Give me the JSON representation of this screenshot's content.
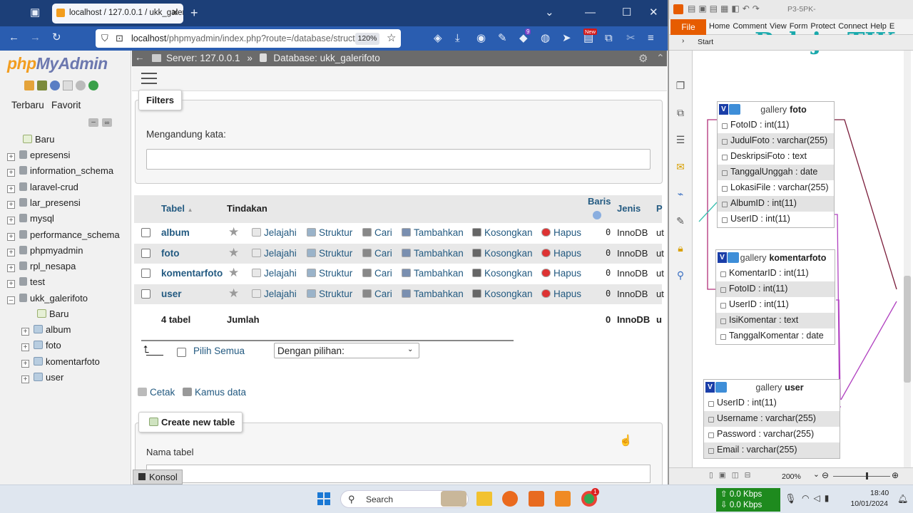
{
  "browser": {
    "tab_title": "localhost / 127.0.0.1 / ukk_galer",
    "url_host": "localhost",
    "url_path": "/phpmyadmin/index.php?route=/database/structur",
    "zoom": "120%",
    "badge_ext": "9",
    "badge_new": "New"
  },
  "pma": {
    "logo_php": "php",
    "logo_my": "MyAdmin",
    "tab_recent": "Terbaru",
    "tab_fav": "Favorit",
    "tree": {
      "new_root": "Baru",
      "databases": [
        "epresensi",
        "information_schema",
        "laravel-crud",
        "lar_presensi",
        "mysql",
        "performance_schema",
        "phpmyadmin",
        "rpl_nesapa",
        "test",
        "ukk_galerifoto"
      ],
      "new_child": "Baru",
      "tables": [
        "album",
        "foto",
        "komentarfoto",
        "user"
      ]
    },
    "breadcrumb": {
      "server": "Server: 127.0.0.1",
      "sep": "»",
      "database": "Database: ukk_galerifoto"
    },
    "filters": {
      "legend": "Filters",
      "label": "Mengandung kata:",
      "value": ""
    },
    "table": {
      "headers": {
        "table": "Tabel",
        "actions": "Tindakan",
        "rows": "Baris",
        "type": "Jenis",
        "collation": "P"
      },
      "action_labels": {
        "browse": "Jelajahi",
        "structure": "Struktur",
        "search": "Cari",
        "insert": "Tambahkan",
        "empty": "Kosongkan",
        "drop": "Hapus"
      },
      "rows": [
        {
          "name": "album",
          "rows": "0",
          "type": "InnoDB",
          "collation": "ut"
        },
        {
          "name": "foto",
          "rows": "0",
          "type": "InnoDB",
          "collation": "ut"
        },
        {
          "name": "komentarfoto",
          "rows": "0",
          "type": "InnoDB",
          "collation": "ut"
        },
        {
          "name": "user",
          "rows": "0",
          "type": "InnoDB",
          "collation": "ut"
        }
      ],
      "footer": {
        "count": "4 tabel",
        "sum": "Jumlah",
        "rows": "0",
        "type": "InnoDB",
        "collation": "u"
      }
    },
    "select_all": "Pilih Semua",
    "with_selected": "Dengan pilihan:",
    "print": "Cetak",
    "dictionary": "Kamus data",
    "create_table": {
      "legend": "Create new table",
      "label": "Nama tabel"
    },
    "console": "Konsol"
  },
  "pdf": {
    "title_frag": "P3-5PK-",
    "watermark": "BelajarTIK",
    "ribbon_file": "File",
    "ribbon_menu": [
      "Home",
      "Comment",
      "View",
      "Form",
      "Protect",
      "Connect",
      "Help",
      "E"
    ],
    "start_tab": "Start",
    "zoom": "200%",
    "entities": [
      {
        "prefix": "gallery",
        "name": "foto",
        "fields": [
          "FotoID : int(11)",
          "JudulFoto : varchar(255)",
          "DeskripsiFoto : text",
          "TanggalUnggah : date",
          "LokasiFile : varchar(255)",
          "AlbumID : int(11)",
          "UserID : int(11)"
        ]
      },
      {
        "prefix": "gallery",
        "name": "komentarfoto",
        "fields": [
          "KomentarID : int(11)",
          "FotoID : int(11)",
          "UserID : int(11)",
          "IsiKomentar : text",
          "TanggalKomentar : date"
        ]
      },
      {
        "prefix": "gallery",
        "name": "user",
        "fields": [
          "UserID : int(11)",
          "Username : varchar(255)",
          "Password : varchar(255)",
          "Email : varchar(255)"
        ]
      }
    ]
  },
  "taskbar": {
    "search": "Search",
    "kbps_up": "0.0 Kbps",
    "kbps_down": "0.0 Kbps",
    "time": "18:40",
    "date": "10/01/2024",
    "chrome_badge": "1"
  },
  "colors": {
    "pma_link": "#235a81",
    "titlebar": "#1c3f78",
    "navbar": "#2a5db0",
    "relation_line": "#b0307a"
  }
}
